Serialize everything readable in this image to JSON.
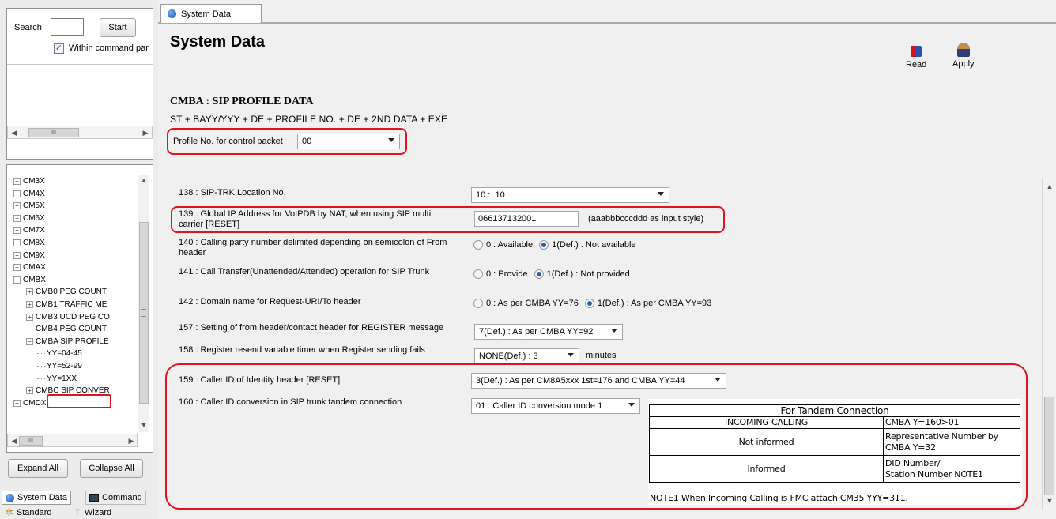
{
  "left_panel": {
    "search_label": "Search",
    "search_value": "",
    "start_button": "Start",
    "within_label": "Within command par",
    "within_checked": true,
    "scroll_thumb_glyph": "III",
    "tree": [
      {
        "label": "CM3X",
        "expander": "+"
      },
      {
        "label": "CM4X",
        "expander": "+"
      },
      {
        "label": "CM5X",
        "expander": "+"
      },
      {
        "label": "CM6X",
        "expander": "+"
      },
      {
        "label": "CM7X",
        "expander": "+"
      },
      {
        "label": "CM8X",
        "expander": "+"
      },
      {
        "label": "CM9X",
        "expander": "+"
      },
      {
        "label": "CMAX",
        "expander": "+"
      },
      {
        "label": "CMBX",
        "expander": "-"
      },
      {
        "label": "CMB0 PEG COUNT",
        "expander": "+"
      },
      {
        "label": "CMB1 TRAFFIC ME",
        "expander": "+"
      },
      {
        "label": "CMB3 UCD PEG CO",
        "expander": "+"
      },
      {
        "label": "CMB4 PEG COUNT",
        "expander": ""
      },
      {
        "label": "CMBA SIP PROFILE",
        "expander": "-"
      },
      {
        "label": "YY=04-45",
        "expander": ""
      },
      {
        "label": "YY=52-99",
        "expander": ""
      },
      {
        "label": "YY=1XX",
        "expander": ""
      },
      {
        "label": "CMBC SIP CONVER",
        "expander": "+"
      },
      {
        "label": "CMDX",
        "expander": "+"
      }
    ],
    "expand_all": "Expand All",
    "collapse_all": "Collapse All",
    "bottom_tabs": {
      "system_data": "System Data",
      "command": "Command",
      "standard": "Standard",
      "wizard": "Wizard"
    }
  },
  "top_tab": "System Data",
  "main": {
    "title": "System Data",
    "read": "Read",
    "apply": "Apply",
    "section_title": "CMBA : SIP PROFILE DATA",
    "command_syntax": "ST + BAYY/YYY + DE + PROFILE NO. + DE + 2ND DATA + EXE",
    "profile_label": "Profile No. for control packet",
    "profile_value": "00",
    "rows": {
      "r138": {
        "label": "138 : SIP-TRK Location No.",
        "value": "10 :  10"
      },
      "r139": {
        "label": "139 : Global IP Address for VoIPDB by NAT, when using SIP multi carrier [RESET]",
        "value": "066137132001",
        "hint": "(aaabbbcccddd as input style)"
      },
      "r140": {
        "label": "140 : Calling party number delimited depending on semicolon of From header",
        "opt0": "0 : Available",
        "opt1": "1(Def.) : Not available"
      },
      "r141": {
        "label": "141 : Call Transfer(Unattended/Attended) operation for SIP Trunk",
        "opt0": "0 : Provide",
        "opt1": "1(Def.) : Not provided"
      },
      "r142": {
        "label": "142 : Domain name for Request-URI/To header",
        "opt0": "0 : As per CMBA YY=76",
        "opt1": "1(Def.) : As per CMBA YY=93"
      },
      "r157": {
        "label": "157 : Setting of from header/contact header for REGISTER message",
        "value": "7(Def.) : As per CMBA YY=92"
      },
      "r158": {
        "label": "158 : Register resend variable timer when Register sending fails",
        "value": "NONE(Def.) : 3",
        "unit": "minutes"
      },
      "r159": {
        "label": "159 : Caller ID of Identity header [RESET]",
        "value": "3(Def.) : As per CM8A5xxx 1st=176 and CMBA YY=44"
      },
      "r160": {
        "label": "160 : Caller ID conversion in SIP trunk tandem connection",
        "value": "01 : Caller ID conversion mode 1"
      }
    },
    "tandem_table": {
      "title": "For Tandem Connection",
      "header_left": "INCOMING CALLING",
      "header_right": "CMBA Y=160>01",
      "row1_left": "Not informed",
      "row1_right_a": "Representative Number by",
      "row1_right_b": "CMBA Y=32",
      "row2_left": "Informed",
      "row2_right_a": "DID Number/",
      "row2_right_b": "Station Number NOTE1",
      "note": "NOTE1 When Incoming Calling is FMC attach CM35 YYY=311."
    }
  },
  "colors": {
    "highlight": "#e0141e",
    "radio_dot": "#2b5cb8"
  }
}
